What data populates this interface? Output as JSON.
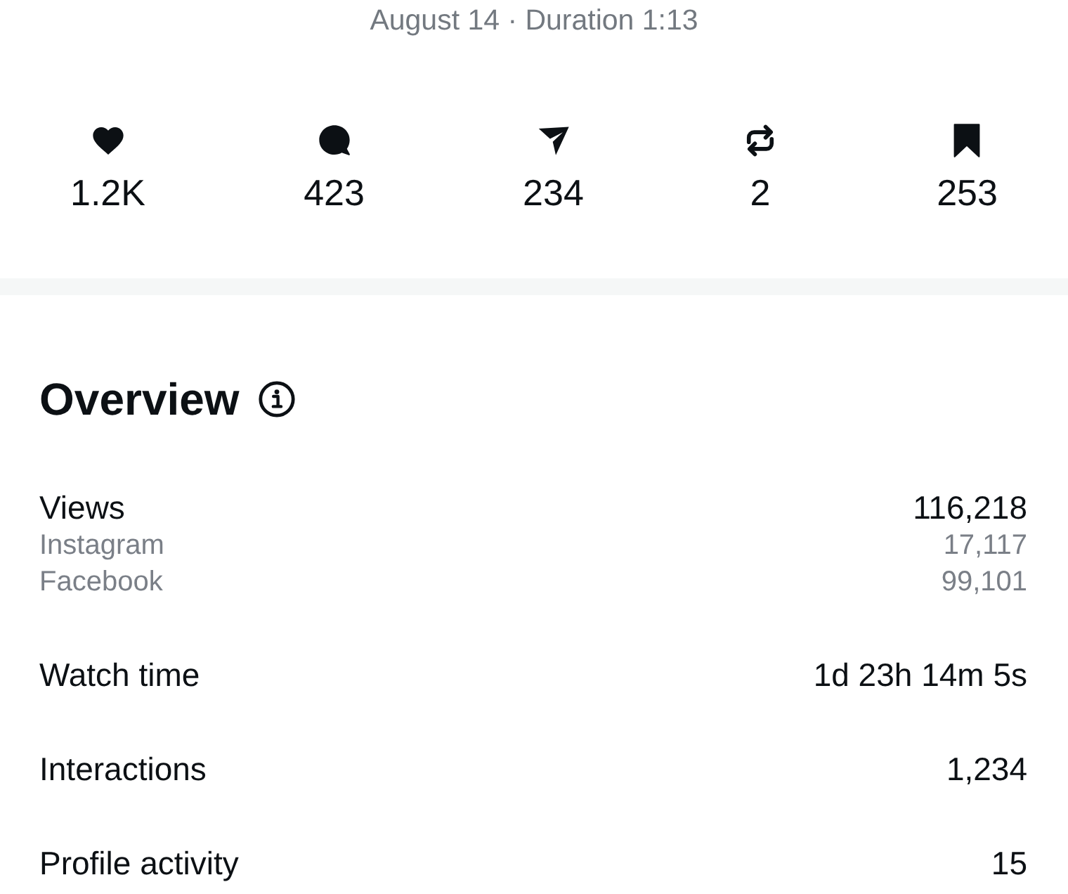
{
  "header": {
    "subtitle": "August 14 · Duration 1:13"
  },
  "stats": [
    {
      "kind": "likes",
      "value": "1.2K"
    },
    {
      "kind": "comments",
      "value": "423"
    },
    {
      "kind": "shares",
      "value": "234"
    },
    {
      "kind": "reposts",
      "value": "2"
    },
    {
      "kind": "saves",
      "value": "253"
    }
  ],
  "overview": {
    "title": "Overview",
    "metrics": [
      {
        "label": "Views",
        "value": "116,218",
        "breakdown": [
          {
            "label": "Instagram",
            "value": "17,117"
          },
          {
            "label": "Facebook",
            "value": "99,101"
          }
        ]
      },
      {
        "label": "Watch time",
        "value": "1d 23h 14m 5s"
      },
      {
        "label": "Interactions",
        "value": "1,234"
      },
      {
        "label": "Profile activity",
        "value": "15"
      }
    ]
  }
}
